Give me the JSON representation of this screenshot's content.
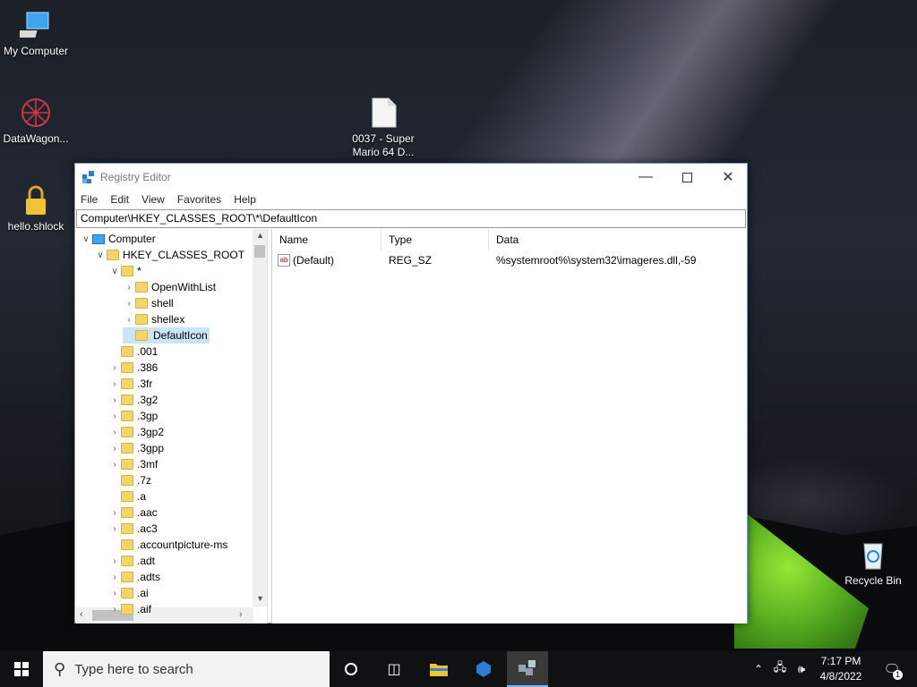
{
  "desktop": {
    "icons": [
      {
        "label": "My Computer",
        "icon": "computer-icon"
      },
      {
        "label": "DataWagon...",
        "icon": "datawagon-icon"
      },
      {
        "label": "hello.shlock",
        "icon": "lock-icon"
      },
      {
        "label": "0037 - Super Mario 64 D...",
        "icon": "file-icon"
      },
      {
        "label": "Recycle Bin",
        "icon": "recycle-bin-icon"
      }
    ]
  },
  "window": {
    "title": "Registry Editor",
    "menu": [
      "File",
      "Edit",
      "View",
      "Favorites",
      "Help"
    ],
    "address": "Computer\\HKEY_CLASSES_ROOT\\*\\DefaultIcon",
    "tree": [
      {
        "label": "Computer",
        "level": 0,
        "expander": "v",
        "icon": "computer"
      },
      {
        "label": "HKEY_CLASSES_ROOT",
        "level": 1,
        "expander": "v",
        "icon": "folder"
      },
      {
        "label": "*",
        "level": 2,
        "expander": "v",
        "icon": "folder"
      },
      {
        "label": "OpenWithList",
        "level": 3,
        "expander": ">",
        "icon": "folder"
      },
      {
        "label": "shell",
        "level": 3,
        "expander": ">",
        "icon": "folder"
      },
      {
        "label": "shellex",
        "level": 3,
        "expander": ">",
        "icon": "folder"
      },
      {
        "label": "DefaultIcon",
        "level": 3,
        "expander": "",
        "icon": "folder",
        "selected": true
      },
      {
        "label": ".001",
        "level": 2,
        "expander": "",
        "icon": "folder"
      },
      {
        "label": ".386",
        "level": 2,
        "expander": ">",
        "icon": "folder"
      },
      {
        "label": ".3fr",
        "level": 2,
        "expander": ">",
        "icon": "folder"
      },
      {
        "label": ".3g2",
        "level": 2,
        "expander": ">",
        "icon": "folder"
      },
      {
        "label": ".3gp",
        "level": 2,
        "expander": ">",
        "icon": "folder"
      },
      {
        "label": ".3gp2",
        "level": 2,
        "expander": ">",
        "icon": "folder"
      },
      {
        "label": ".3gpp",
        "level": 2,
        "expander": ">",
        "icon": "folder"
      },
      {
        "label": ".3mf",
        "level": 2,
        "expander": ">",
        "icon": "folder"
      },
      {
        "label": ".7z",
        "level": 2,
        "expander": "",
        "icon": "folder"
      },
      {
        "label": ".a",
        "level": 2,
        "expander": "",
        "icon": "folder"
      },
      {
        "label": ".aac",
        "level": 2,
        "expander": ">",
        "icon": "folder"
      },
      {
        "label": ".ac3",
        "level": 2,
        "expander": ">",
        "icon": "folder"
      },
      {
        "label": ".accountpicture-ms",
        "level": 2,
        "expander": "",
        "icon": "folder"
      },
      {
        "label": ".adt",
        "level": 2,
        "expander": ">",
        "icon": "folder"
      },
      {
        "label": ".adts",
        "level": 2,
        "expander": ">",
        "icon": "folder"
      },
      {
        "label": ".ai",
        "level": 2,
        "expander": ">",
        "icon": "folder"
      },
      {
        "label": ".aif",
        "level": 2,
        "expander": ">",
        "icon": "folder"
      }
    ],
    "columns": [
      "Name",
      "Type",
      "Data"
    ],
    "values": [
      {
        "name": "(Default)",
        "type": "REG_SZ",
        "data": "%systemroot%\\system32\\imageres.dll,-59"
      }
    ]
  },
  "taskbar": {
    "search_placeholder": "Type here to search",
    "time": "7:17 PM",
    "date": "4/8/2022",
    "notification_count": "1",
    "apps": [
      "task-view-icon",
      "file-explorer-icon",
      "app-icon",
      "registry-editor-icon"
    ]
  }
}
